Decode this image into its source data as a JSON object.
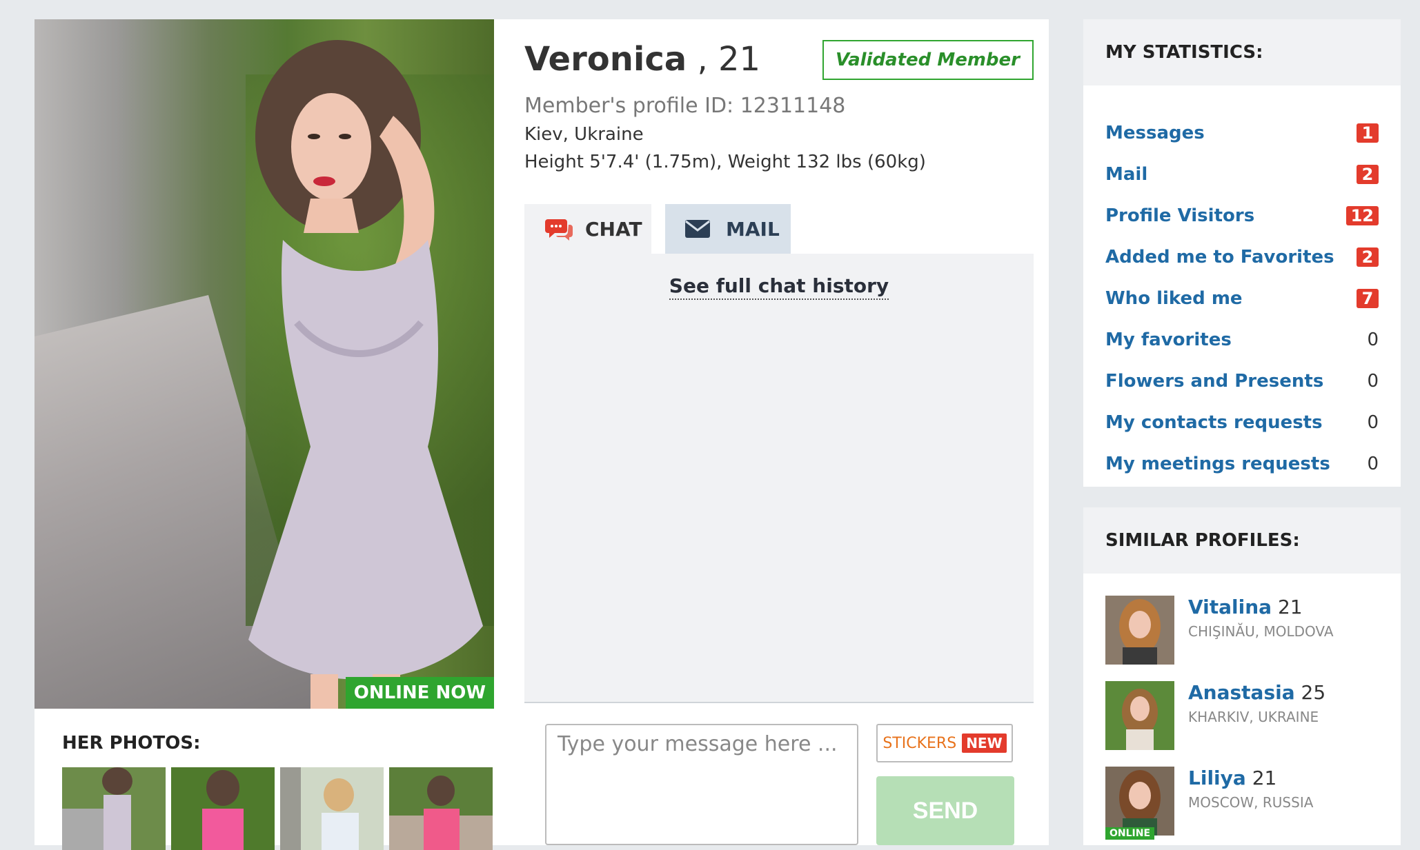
{
  "profile": {
    "name": "Veronica",
    "age_sep": ", 21",
    "validated": "Validated Member",
    "profile_id": "Member's profile ID: 12311148",
    "city": "Kiev, Ukraine",
    "height": "Height 5'7.4' (1.75m), Weight 132 lbs (60kg)",
    "online": "ONLINE NOW"
  },
  "photos": {
    "title": "HER PHOTOS:"
  },
  "tabs": {
    "chat": "CHAT",
    "mail": "MAIL"
  },
  "chat": {
    "history_link": "See full chat history",
    "placeholder": "Type your message here ...",
    "stickers": "STICKERS",
    "new_badge": "NEW",
    "send": "SEND"
  },
  "stats": {
    "title": "MY STATISTICS:",
    "items": [
      {
        "label": "Messages",
        "value": "1"
      },
      {
        "label": "Mail",
        "value": "2"
      },
      {
        "label": "Profile Visitors",
        "value": "12"
      },
      {
        "label": "Added me to Favorites",
        "value": "2"
      },
      {
        "label": "Who liked me",
        "value": "7"
      },
      {
        "label": "My favorites",
        "value": "0"
      },
      {
        "label": "Flowers and Presents",
        "value": "0"
      },
      {
        "label": "My contacts requests",
        "value": "0"
      },
      {
        "label": "My meetings requests",
        "value": "0"
      }
    ]
  },
  "similar": {
    "title": "SIMILAR PROFILES:",
    "items": [
      {
        "name": "Vitalina",
        "age": "21",
        "location": "CHIŞINĂU, MOLDOVA"
      },
      {
        "name": "Anastasia",
        "age": "25",
        "location": "KHARKIV, UKRAINE"
      },
      {
        "name": "Liliya",
        "age": "21",
        "location": "MOSCOW, RUSSIA",
        "online": "ONLINE"
      }
    ]
  },
  "colors": {
    "link_blue": "#1f6aa5",
    "badge_red": "#e33b2c",
    "online_green": "#2fa52f",
    "send_green": "#b6dfb6"
  }
}
